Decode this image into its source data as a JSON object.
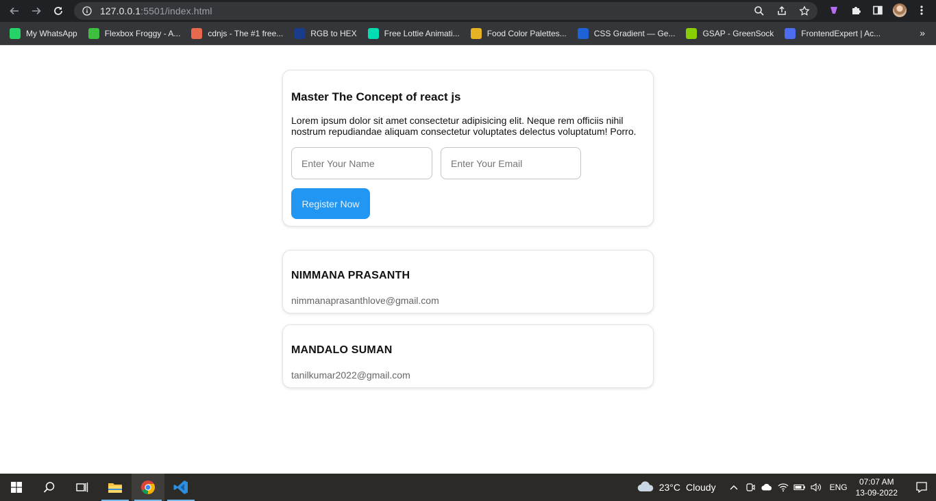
{
  "browser": {
    "url_host": "127.0.0.1",
    "url_path": ":5501/index.html",
    "bookmarks": [
      {
        "label": "My WhatsApp",
        "icon": "whatsapp-icon",
        "color": "#25d366"
      },
      {
        "label": "Flexbox Froggy - A...",
        "icon": "frog-icon",
        "color": "#3fbf3f"
      },
      {
        "label": "cdnjs - The #1 free...",
        "icon": "code-brackets-icon",
        "color": "#e8694b"
      },
      {
        "label": "RGB to HEX",
        "icon": "rgb-hex-icon",
        "color": "#1a3c8c"
      },
      {
        "label": "Free Lottie Animati...",
        "icon": "lottie-icon",
        "color": "#00ddb3"
      },
      {
        "label": "Food Color Palettes...",
        "icon": "palette-icon",
        "color": "#e6b422"
      },
      {
        "label": "CSS Gradient — Ge...",
        "icon": "gradient-icon",
        "color": "#1e63d6"
      },
      {
        "label": "GSAP - GreenSock",
        "icon": "gsap-icon",
        "color": "#88ce02"
      },
      {
        "label": "FrontendExpert | Ac...",
        "icon": "frontendexpert-icon",
        "color": "#4d6df0"
      }
    ]
  },
  "page": {
    "title": "Master The Concept of react js",
    "description": "Lorem ipsum dolor sit amet consectetur adipisicing elit. Neque rem officiis nihil nostrum repudiandae aliquam consectetur voluptates delectus voluptatum! Porro.",
    "name_placeholder": "Enter Your Name",
    "email_placeholder": "Enter Your Email",
    "register_label": "Register Now",
    "accent": "#2196f3",
    "users": [
      {
        "name": "NIMMANA PRASANTH",
        "email": "nimmanaprasanthlove@gmail.com"
      },
      {
        "name": "MANDALO SUMAN",
        "email": "tanilkumar2022@gmail.com"
      }
    ]
  },
  "taskbar": {
    "temperature": "23°C",
    "weather": "Cloudy",
    "language": "ENG",
    "time": "07:07 AM",
    "date": "13-09-2022"
  }
}
